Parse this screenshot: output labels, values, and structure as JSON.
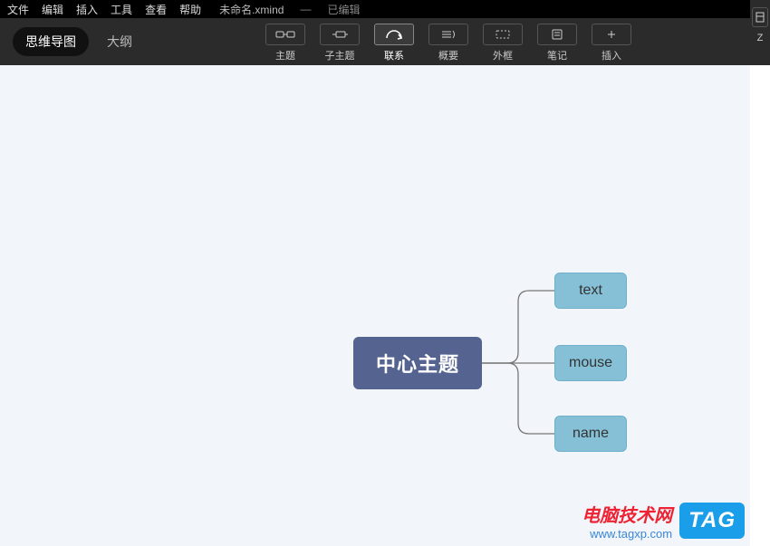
{
  "menubar": {
    "items": [
      "文件",
      "编辑",
      "插入",
      "工具",
      "查看",
      "帮助"
    ],
    "filename": "未命名.xmind",
    "status_prefix": "—",
    "status": "已编辑"
  },
  "view_tabs": {
    "mindmap": "思维导图",
    "outline": "大纲"
  },
  "toolbar": {
    "topic": "主题",
    "subtopic": "子主题",
    "relationship": "联系",
    "summary": "概要",
    "boundary": "外框",
    "notes": "笔记",
    "insert": "插入",
    "right_cut": "Z"
  },
  "mindmap": {
    "central": "中心主题",
    "children": [
      "text",
      "mouse",
      "name"
    ]
  },
  "watermark": {
    "line1": "电脑技术网",
    "line2": "www.tagxp.com",
    "tag": "TAG"
  }
}
